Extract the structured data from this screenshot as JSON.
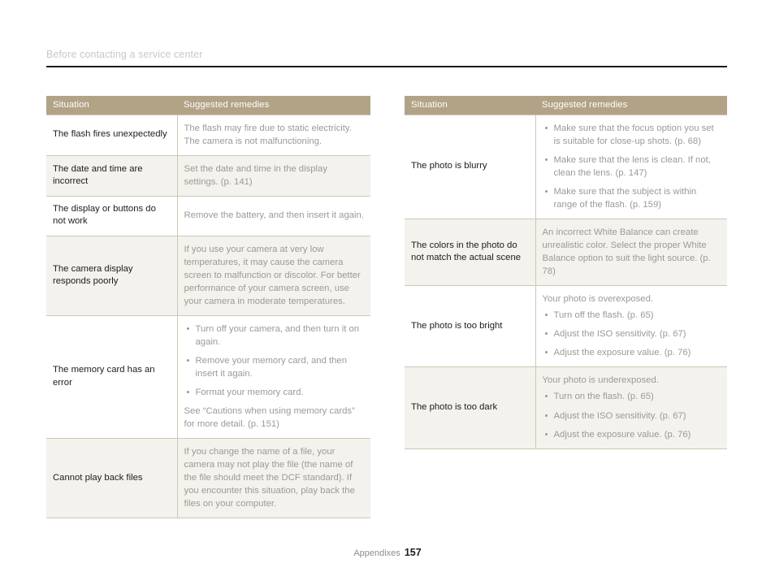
{
  "header": {
    "title": "Before contacting a service center"
  },
  "tables": {
    "columns": {
      "situation": "Situation",
      "remedies": "Suggested remedies"
    },
    "left_rows": [
      {
        "situation": "The flash fires unexpectedly",
        "lines": [
          "The flash may fire due to static electricity.",
          "The camera is not malfunctioning."
        ]
      },
      {
        "situation": "The date and time are incorrect",
        "lines": [
          "Set the date and time in the display settings. (p. 141)"
        ]
      },
      {
        "situation": "The display or buttons do not work",
        "lines": [
          "Remove the battery, and then insert it again."
        ]
      },
      {
        "situation": "The camera display responds poorly",
        "lines": [
          "If you use your camera at very low temperatures, it may cause the camera screen to malfunction or discolor. For better performance of your camera screen, use your camera in moderate temperatures."
        ]
      },
      {
        "situation": "The memory card has an error",
        "bullets": [
          "Turn off your camera, and then turn it on again.",
          "Remove your memory card, and then insert it again.",
          "Format your memory card."
        ],
        "after": "See “Cautions when using memory cards” for more detail. (p. 151)"
      },
      {
        "situation": "Cannot play back files",
        "lines": [
          "If you change the name of a file, your camera may not play the file (the name of the file should meet the DCF standard). If you encounter this situation, play back the files on your computer."
        ]
      }
    ],
    "right_rows": [
      {
        "situation": "The photo is blurry",
        "bullets": [
          "Make sure that the focus option you set is suitable for close-up shots. (p. 68)",
          "Make sure that the lens is clean. If not, clean the lens. (p. 147)",
          "Make sure that the subject is within range of the flash. (p. 159)"
        ]
      },
      {
        "situation": "The colors in the photo do not match the actual scene",
        "lines": [
          "An incorrect White Balance can create unrealistic color. Select the proper White Balance option to suit the light source. (p. 78)"
        ]
      },
      {
        "situation": "The photo is too bright",
        "before": "Your photo is overexposed.",
        "bullets": [
          "Turn off the flash. (p. 65)",
          "Adjust the ISO sensitivity. (p. 67)",
          "Adjust the exposure value. (p. 76)"
        ]
      },
      {
        "situation": "The photo is too dark",
        "before": "Your photo is underexposed.",
        "bullets": [
          "Turn on the flash. (p. 65)",
          "Adjust the ISO sensitivity. (p. 67)",
          "Adjust the exposure value. (p. 76)"
        ]
      }
    ]
  },
  "footer": {
    "section": "Appendixes",
    "page_number": "157"
  },
  "colors": {
    "header_band": "#b2a387",
    "row_alt": "#f4f2ed",
    "border": "#cfc7b5",
    "body_text": "#9a9a96",
    "situation_text": "#1c1c1c",
    "title_text": "#c8c8c8"
  }
}
